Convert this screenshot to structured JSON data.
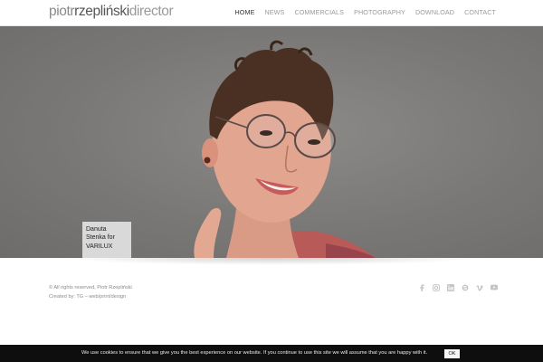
{
  "header": {
    "logo": {
      "part1": "piotr",
      "part2": "rzepliński",
      "part3": "director"
    },
    "nav": [
      {
        "label": "HOME",
        "active": true
      },
      {
        "label": "NEWS",
        "active": false
      },
      {
        "label": "COMMERCIALS",
        "active": false
      },
      {
        "label": "PHOTOGRAPHY",
        "active": false
      },
      {
        "label": "DOWNLOAD",
        "active": false
      },
      {
        "label": "CONTACT",
        "active": false
      }
    ]
  },
  "hero": {
    "caption_line1": "Danuta",
    "caption_line2": "Stenka for",
    "caption_line3": "VARILUX"
  },
  "footer": {
    "copyright": "© All rights reserved, Piotr Rzepliński",
    "credit": "Created by: TG – web/print/design",
    "socials": [
      "facebook-icon",
      "instagram-icon",
      "linkedin-icon",
      "skype-icon",
      "vimeo-icon",
      "youtube-icon"
    ]
  },
  "cookie": {
    "text": "We use cookies to ensure that we give you the best experience on our website. If you continue to use this site we will assume that you are happy with it.",
    "button": "OK"
  },
  "colors": {
    "cookie_bar": "#0e0e0e",
    "nav_active": "#333333",
    "nav": "#9a9a9a"
  }
}
